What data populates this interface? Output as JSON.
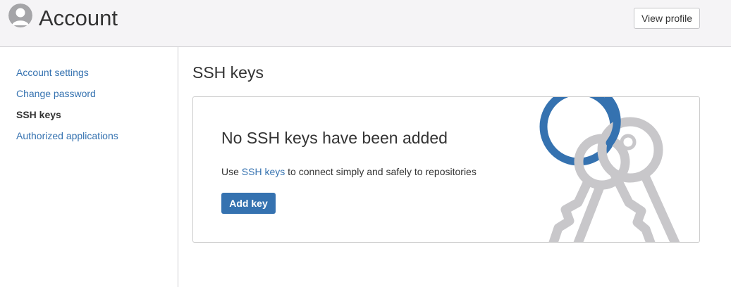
{
  "header": {
    "title": "Account",
    "view_profile_label": "View profile"
  },
  "sidebar": {
    "items": [
      {
        "label": "Account settings",
        "active": false
      },
      {
        "label": "Change password",
        "active": false
      },
      {
        "label": "SSH keys",
        "active": true
      },
      {
        "label": "Authorized applications",
        "active": false
      }
    ]
  },
  "main": {
    "section_title": "SSH keys",
    "empty_state": {
      "title": "No SSH keys have been added",
      "description_prefix": "Use ",
      "description_link": "SSH keys",
      "description_suffix": " to connect simply and safely to repositories",
      "add_key_label": "Add key",
      "illustration_icon": "keys-icon"
    }
  },
  "colors": {
    "link": "#3572b0",
    "primary_button": "#3572b0",
    "header_background": "#f5f4f6",
    "illustration_ring": "#3572b0",
    "illustration_keys": "#c8c7ca"
  }
}
